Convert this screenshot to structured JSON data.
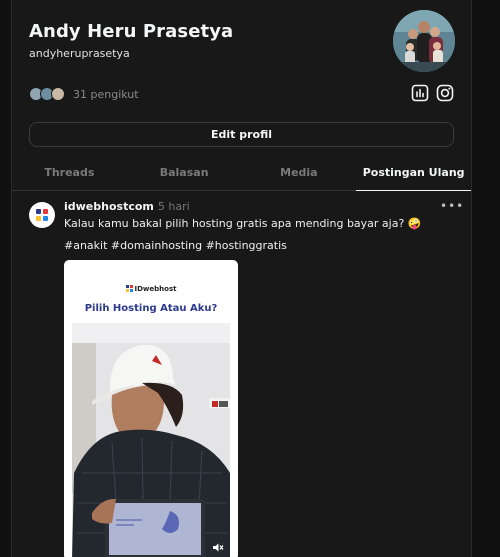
{
  "profile": {
    "name": "Andy Heru Prasetya",
    "username": "andyheruprasetya",
    "followers_text": "31 pengikut",
    "avatar_colors": [
      "#8fa3b0",
      "#6d8ea0",
      "#c9b8a6"
    ]
  },
  "actions": {
    "edit_profile": "Edit profil",
    "insights_icon": "bar-chart-icon",
    "instagram_icon": "instagram-icon"
  },
  "tabs": [
    {
      "label": "Threads"
    },
    {
      "label": "Balasan"
    },
    {
      "label": "Media"
    },
    {
      "label": "Postingan Ulang",
      "active": true
    }
  ],
  "post": {
    "author": "idwebhostcom",
    "time": "5 hari",
    "text": "Kalau kamu bakal pilih hosting gratis apa mending bayar aja? 🤪",
    "tags": "#anakit #domainhosting #hostinggratis",
    "media": {
      "brand": "IDwebhost",
      "title": "Pilih Hosting Atau Aku?"
    }
  },
  "colors": {
    "background": "#101010",
    "panel": "#181818",
    "accent_title": "#2d3a8c"
  }
}
